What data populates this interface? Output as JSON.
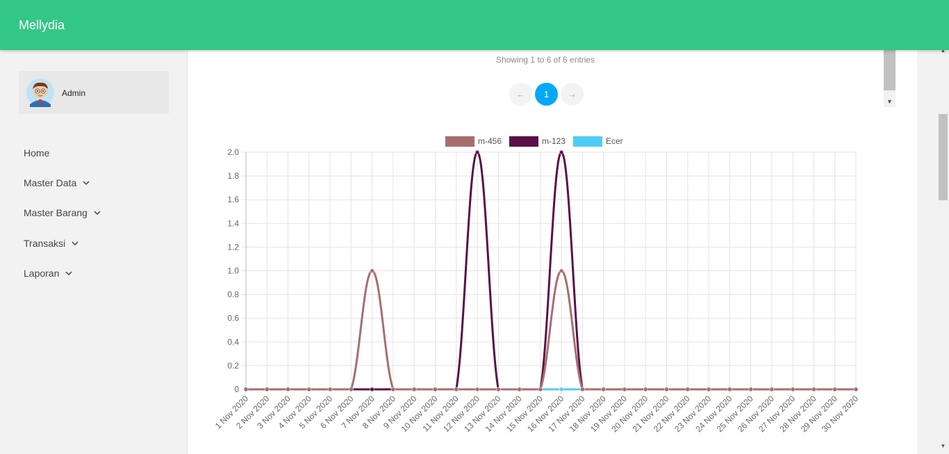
{
  "app": {
    "title": "Mellydia"
  },
  "user": {
    "name": "Admin"
  },
  "nav": [
    {
      "label": "Home",
      "has_children": false
    },
    {
      "label": "Master Data",
      "has_children": true
    },
    {
      "label": "Master Barang",
      "has_children": true
    },
    {
      "label": "Transaksi",
      "has_children": true
    },
    {
      "label": "Laporan",
      "has_children": true
    }
  ],
  "table_footer": {
    "info": "Showing 1 to 6 of 6 entries"
  },
  "pagination": {
    "prev": "←",
    "current": "1",
    "next": "→"
  },
  "colors": {
    "header": "#33c787",
    "accent": "#03a9f4"
  },
  "chart_data": {
    "type": "line",
    "categories": [
      "1 Nov 2020",
      "2 Nov 2020",
      "3 Nov 2020",
      "4 Nov 2020",
      "5 Nov 2020",
      "6 Nov 2020",
      "7 Nov 2020",
      "8 Nov 2020",
      "9 Nov 2020",
      "10 Nov 2020",
      "11 Nov 2020",
      "12 Nov 2020",
      "13 Nov 2020",
      "14 Nov 2020",
      "15 Nov 2020",
      "16 Nov 2020",
      "17 Nov 2020",
      "18 Nov 2020",
      "19 Nov 2020",
      "20 Nov 2020",
      "21 Nov 2020",
      "22 Nov 2020",
      "23 Nov 2020",
      "24 Nov 2020",
      "25 Nov 2020",
      "26 Nov 2020",
      "27 Nov 2020",
      "28 Nov 2020",
      "29 Nov 2020",
      "30 Nov 2020"
    ],
    "series": [
      {
        "name": "m-456",
        "color": "#a86e6e",
        "values": [
          0,
          0,
          0,
          0,
          0,
          0,
          1,
          0,
          0,
          0,
          0,
          0,
          0,
          0,
          0,
          1,
          0,
          0,
          0,
          0,
          0,
          0,
          0,
          0,
          0,
          0,
          0,
          0,
          0,
          0
        ]
      },
      {
        "name": "m-123",
        "color": "#5b1047",
        "values": [
          0,
          0,
          0,
          0,
          0,
          0,
          0,
          0,
          0,
          0,
          0,
          2,
          0,
          0,
          0,
          2,
          0,
          0,
          0,
          0,
          0,
          0,
          0,
          0,
          0,
          0,
          0,
          0,
          0,
          0
        ]
      },
      {
        "name": "Ecer",
        "color": "#4dcdf5",
        "values": [
          0,
          0,
          0,
          0,
          0,
          0,
          0,
          0,
          0,
          0,
          0,
          0,
          0,
          0,
          0,
          0,
          0,
          0,
          0,
          0,
          0,
          0,
          0,
          0,
          0,
          0,
          0,
          0,
          0,
          0
        ]
      }
    ],
    "yticks": [
      "0",
      "0.2",
      "0.4",
      "0.6",
      "0.8",
      "1.0",
      "1.2",
      "1.4",
      "1.6",
      "1.8",
      "2.0"
    ],
    "ylim": [
      0,
      2
    ],
    "grid": true,
    "legend": "top-center"
  }
}
